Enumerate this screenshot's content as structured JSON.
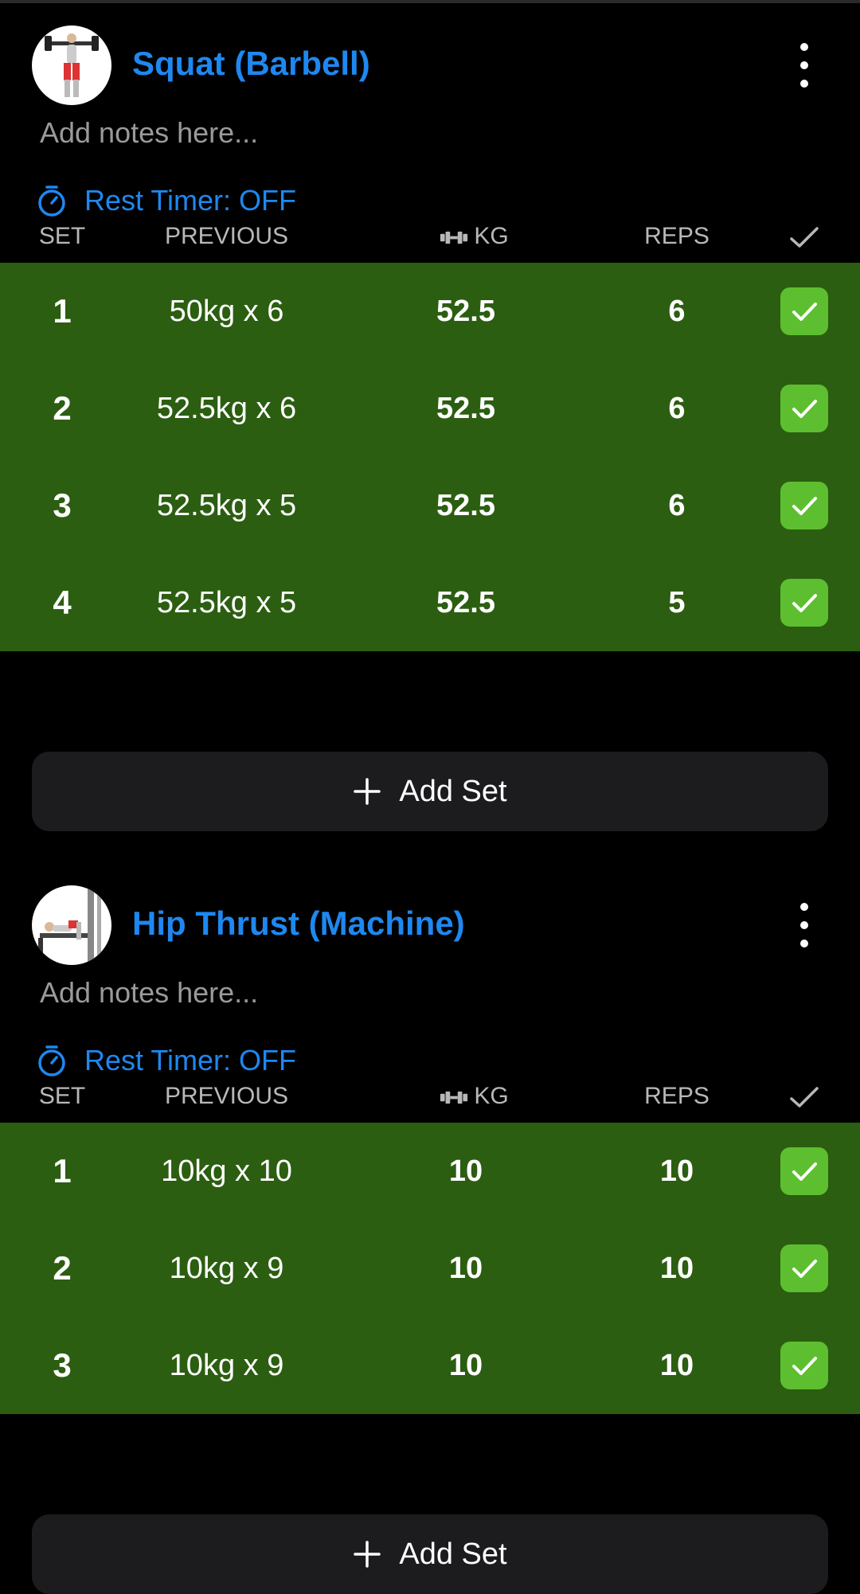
{
  "colors": {
    "accent": "#1e88f0",
    "completed_row": "#2c5e11",
    "check_green": "#5dbf2f",
    "button_bg": "#1c1c1e"
  },
  "columns": {
    "set": "SET",
    "previous": "PREVIOUS",
    "kg": "KG",
    "reps": "REPS"
  },
  "add_set_label": "Add Set",
  "exercises": [
    {
      "title": "Squat (Barbell)",
      "notes_placeholder": "Add notes here...",
      "rest_timer": "Rest Timer: OFF",
      "sets": [
        {
          "set": "1",
          "previous": "50kg x 6",
          "kg": "52.5",
          "reps": "6",
          "done": true
        },
        {
          "set": "2",
          "previous": "52.5kg x 6",
          "kg": "52.5",
          "reps": "6",
          "done": true
        },
        {
          "set": "3",
          "previous": "52.5kg x 5",
          "kg": "52.5",
          "reps": "6",
          "done": true
        },
        {
          "set": "4",
          "previous": "52.5kg x 5",
          "kg": "52.5",
          "reps": "5",
          "done": true
        }
      ]
    },
    {
      "title": "Hip Thrust (Machine)",
      "notes_placeholder": "Add notes here...",
      "rest_timer": "Rest Timer: OFF",
      "sets": [
        {
          "set": "1",
          "previous": "10kg x 10",
          "kg": "10",
          "reps": "10",
          "done": true
        },
        {
          "set": "2",
          "previous": "10kg x 9",
          "kg": "10",
          "reps": "10",
          "done": true
        },
        {
          "set": "3",
          "previous": "10kg x 9",
          "kg": "10",
          "reps": "10",
          "done": true
        }
      ]
    }
  ]
}
